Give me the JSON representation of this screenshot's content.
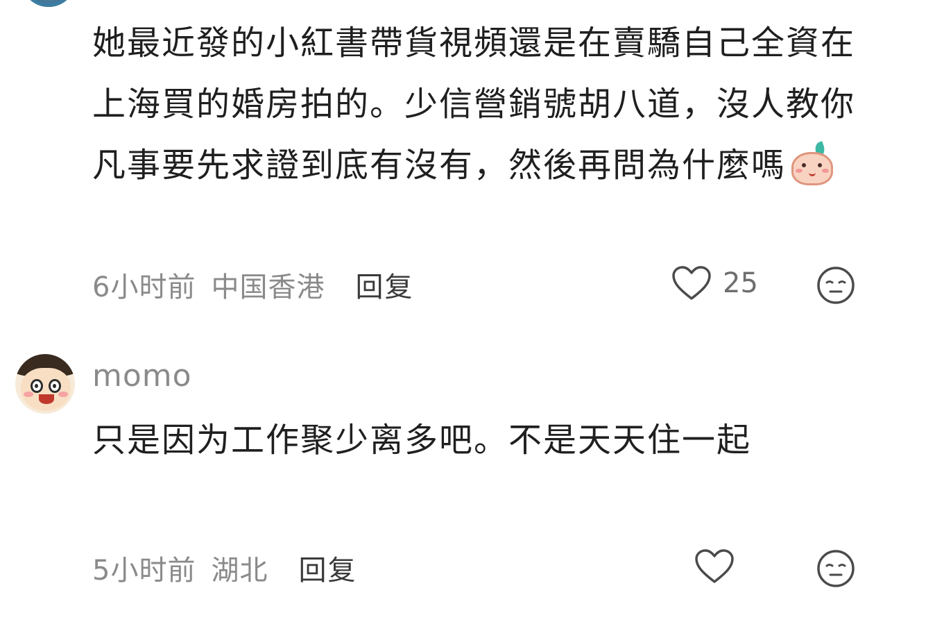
{
  "comments": [
    {
      "text": "她最近發的小紅書帶貨視頻還是在賣驕自己全資在上海買的婚房拍的。少信營銷號胡八道，沒人教你 凡事要先求證到底有沒有，然後再問為什麼嗎",
      "emoji": "peach-smile-emoji",
      "time": "6小时前",
      "location": "中国香港",
      "reply_label": "回复",
      "like_count": "25"
    },
    {
      "username": "momo",
      "text": "只是因为工作聚少离多吧。不是天天住一起",
      "time": "5小时前",
      "location": "湖北",
      "reply_label": "回复",
      "like_count": ""
    }
  ],
  "icons": {
    "like": "heart-outline-icon",
    "dislike": "neutral-face-icon"
  },
  "colors": {
    "text": "#1f1f1f",
    "meta": "#8a8a8a",
    "reply": "#3a3a3a"
  }
}
